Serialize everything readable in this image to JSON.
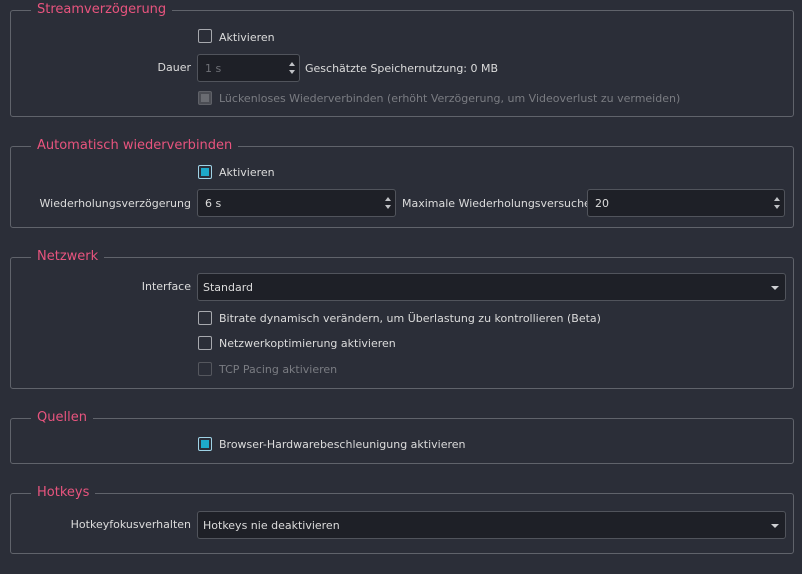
{
  "stream_delay": {
    "title": "Streamverzögerung",
    "enable_label": "Aktivieren",
    "enable_checked": false,
    "duration_label": "Dauer",
    "duration_value": "1 s",
    "memory_label": "Geschätzte Speichernutzung: 0 MB",
    "preserve_label": "Lückenloses Wiederverbinden (erhöht Verzögerung, um Videoverlust zu vermeiden)"
  },
  "auto_reconnect": {
    "title": "Automatisch wiederverbinden",
    "enable_label": "Aktivieren",
    "enable_checked": true,
    "retry_delay_label": "Wiederholungsverzögerung",
    "retry_delay_value": "6 s",
    "max_retries_label": "Maximale Wiederholungsversuche",
    "max_retries_value": "20"
  },
  "network": {
    "title": "Netzwerk",
    "interface_label": "Interface",
    "interface_value": "Standard",
    "dynamic_bitrate_label": "Bitrate dynamisch verändern, um Überlastung zu kontrollieren (Beta)",
    "net_optimization_label": "Netzwerkoptimierung aktivieren",
    "tcp_pacing_label": "TCP Pacing aktivieren"
  },
  "sources": {
    "title": "Quellen",
    "browser_hw_label": "Browser-Hardwarebeschleunigung aktivieren",
    "browser_hw_checked": true
  },
  "hotkeys": {
    "title": "Hotkeys",
    "focus_label": "Hotkeyfokusverhalten",
    "focus_value": "Hotkeys nie deaktivieren"
  },
  "colors": {
    "background": "#2b2e38",
    "accent_title": "#e8547e",
    "check_fill": "#1da9c9",
    "field_bg": "#1e2027"
  }
}
